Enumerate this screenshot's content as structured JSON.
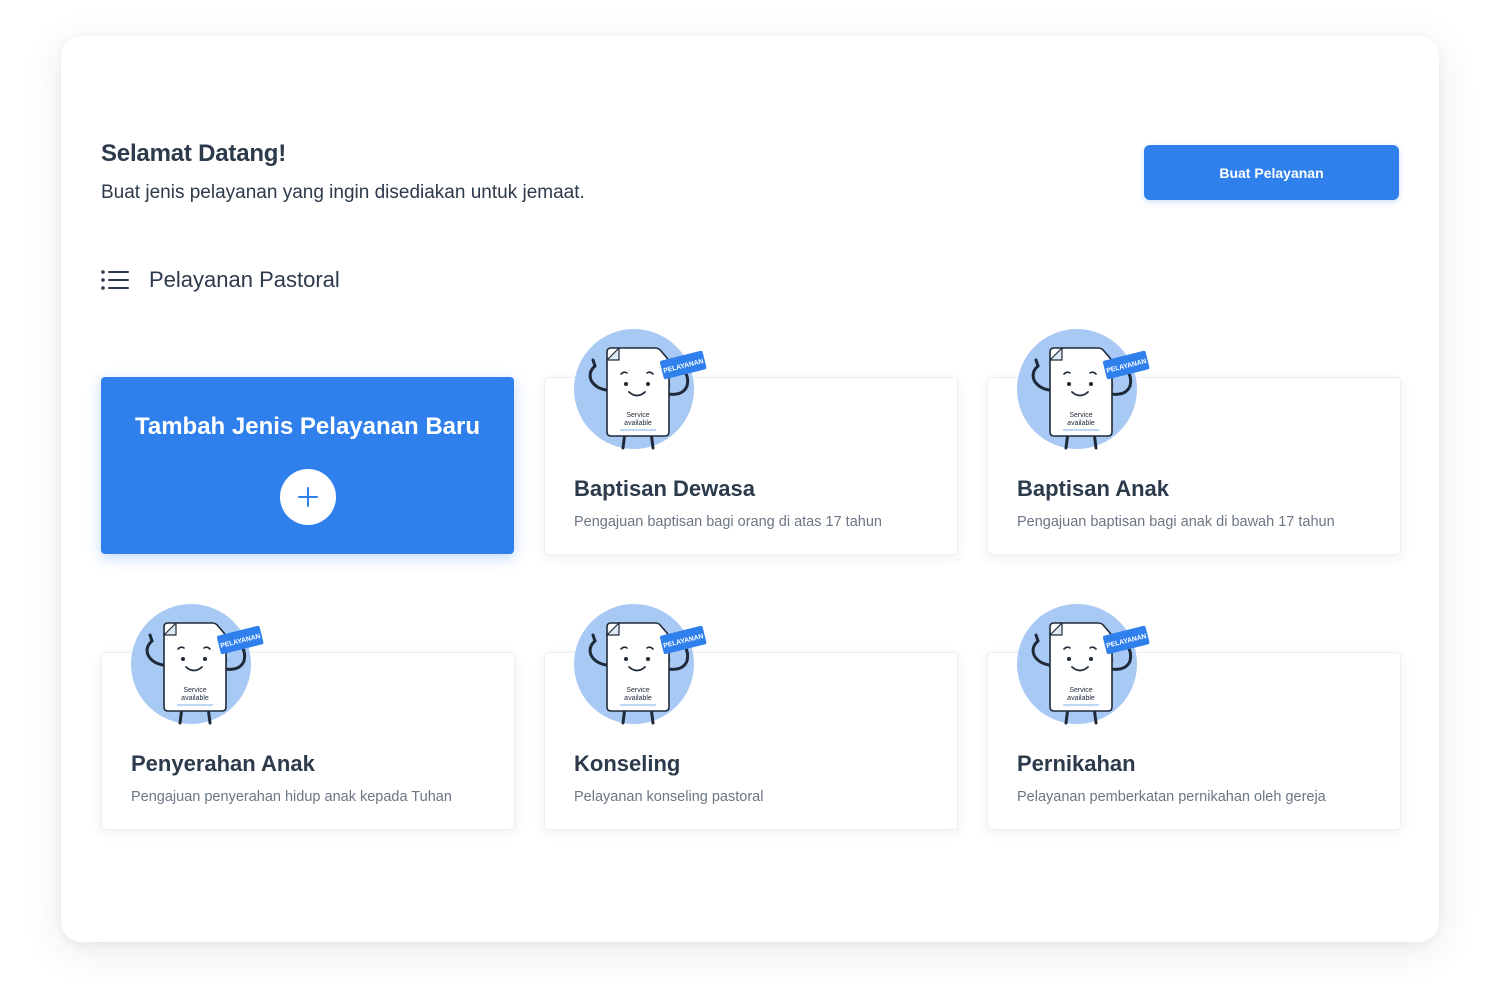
{
  "header": {
    "title": "Selamat Datang!",
    "subtitle": "Buat jenis pelayanan yang ingin disediakan untuk jemaat.",
    "create_button_label": "Buat Pelayanan"
  },
  "section": {
    "icon": "list-icon",
    "title": "Pelayanan Pastoral"
  },
  "add_card": {
    "title": "Tambah Jenis Pelayanan Baru",
    "icon": "plus-icon"
  },
  "mascot": {
    "sign_text": "PELAYANAN",
    "doc_line1": "Service",
    "doc_line2": "available"
  },
  "services": [
    {
      "title": "Baptisan Dewasa",
      "description": "Pengajuan baptisan bagi orang di atas 17 tahun"
    },
    {
      "title": "Baptisan Anak",
      "description": "Pengajuan baptisan bagi anak di bawah 17 tahun"
    },
    {
      "title": "Penyerahan Anak",
      "description": "Pengajuan penyerahan hidup anak kepada Tuhan"
    },
    {
      "title": "Konseling",
      "description": "Pelayanan konseling pastoral"
    },
    {
      "title": "Pernikahan",
      "description": "Pelayanan pemberkatan pernikahan oleh gereja"
    }
  ],
  "colors": {
    "primary": "#2f80ed",
    "mascot_circle": "#a9c9f5",
    "text_dark": "#2c3a4b",
    "text_muted": "#6b7785"
  }
}
